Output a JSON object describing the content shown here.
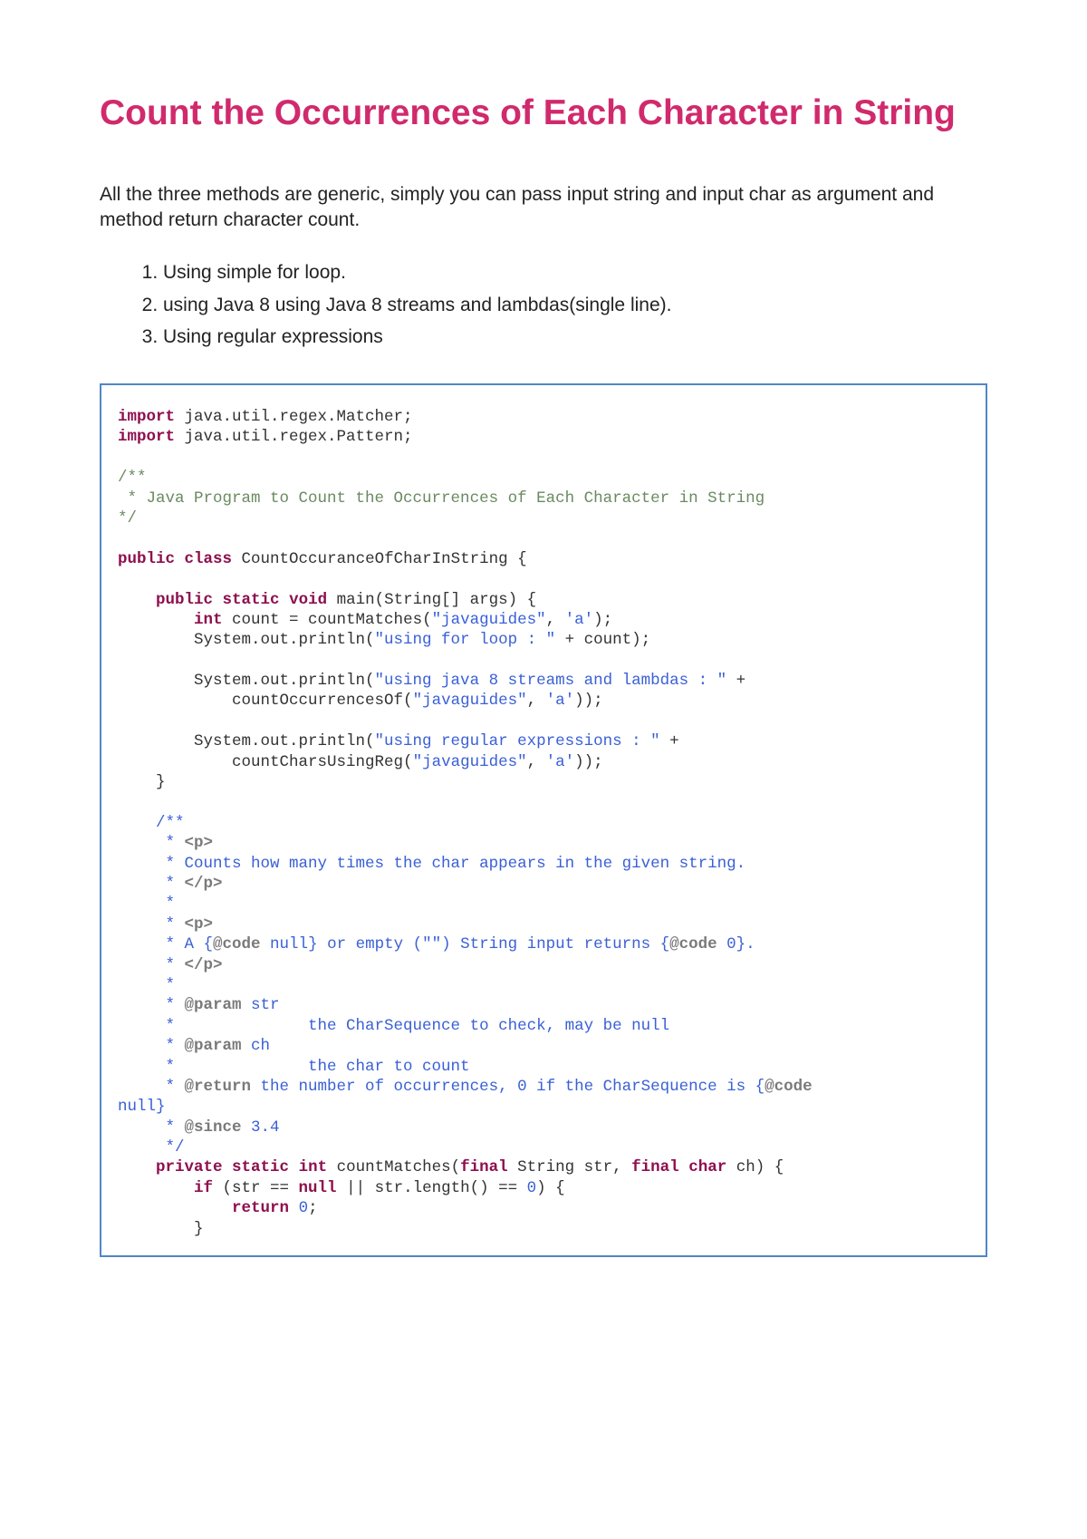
{
  "title": "Count the Occurrences of Each Character in String",
  "intro": "All the three methods are generic, simply you can pass input string and input char as argument and method return character count.",
  "methods": [
    "Using simple for loop.",
    "using Java 8 using Java 8 streams and lambdas(single line).",
    "Using regular expressions"
  ],
  "code": {
    "kw_import1": "import",
    "import1_rest": " java.util.regex.Matcher;",
    "kw_import2": "import",
    "import2_rest": " java.util.regex.Pattern;",
    "cm_open": "/**",
    "cm_body": " * Java Program to Count the Occurrences of Each Character in String",
    "cm_close": "*/",
    "kw_public": "public",
    "kw_class": "class",
    "class_name": " CountOccuranceOfCharInString {",
    "kw_public2": "public",
    "kw_static": "static",
    "kw_void": "void",
    "main_sig_open": " main(",
    "type_string_arr": "String",
    "main_args": "[] args) {",
    "kw_int": "int",
    "line_count_assign_a": " count = countMatches(",
    "str_javaguides1": "\"javaguides\"",
    "sep_comma_sp": ", ",
    "str_a1": "'a'",
    "close_paren_semi": ");",
    "sysout1_a": "        System.out.println(",
    "str_for_loop": "\"using for loop : \"",
    "plus_count": " + count);",
    "sysout2_a": "        System.out.println(",
    "str_streams": "\"using java 8 streams and lambdas : \"",
    "plus_nl1": " +",
    "call_occ_indent": "            countOccurrencesOf(",
    "str_javaguides2": "\"javaguides\"",
    "str_a2": "'a'",
    "close_paren_paren_semi": "));",
    "sysout3_a": "        System.out.println(",
    "str_regex": "\"using regular expressions : \"",
    "plus_nl2": " +",
    "call_reg_indent": "            countCharsUsingReg(",
    "str_javaguides3": "\"javaguides\"",
    "str_a3": "'a'",
    "brace_close_main": "    }",
    "jd_open": "    /**",
    "jd_star": "     *",
    "jd_star_sp": "     * ",
    "tag_p_open": "<p>",
    "jd_counts": "     * Counts how many times the char appears in the given string.",
    "tag_p_close": "</p>",
    "jd_a_prefix": "     * A {",
    "atc_code_null": "@code",
    "jd_null_txt": " null",
    "jd_a_mid": "} or empty (\"\") String input returns {",
    "jd_zero_txt": " 0",
    "jd_a_suffix": "}.",
    "ann_param": "@param",
    "jd_param_str": " str",
    "jd_param_str_desc": "     *              the CharSequence to check, may be null",
    "jd_param_ch": " ch",
    "jd_param_ch_desc": "     *              the char to count",
    "ann_return": "@return",
    "jd_return_txt_a": " the number of occurrences, 0 if the CharSequence is {",
    "jd_return_txt_b": "null}",
    "ann_since": "@since",
    "jd_since_txt": " 3.4",
    "jd_close": "     */",
    "kw_private": "private",
    "kw_static2": "static",
    "kw_int2": "int",
    "cm_name": " countMatches(",
    "kw_final1": "final",
    "type_string": " String",
    "param_str": " str, ",
    "kw_final2": "final",
    "kw_char": " char",
    "param_ch": " ch) {",
    "kw_if": "if",
    "if_cond_a": " (str == ",
    "kw_null1": "null",
    "if_cond_b": " || str.length() == ",
    "lit_0a": "0",
    "if_cond_c": ") {",
    "kw_return": "return",
    "sp": " ",
    "lit_0b": "0",
    "semi": ";",
    "brace_close_if": "        }"
  }
}
